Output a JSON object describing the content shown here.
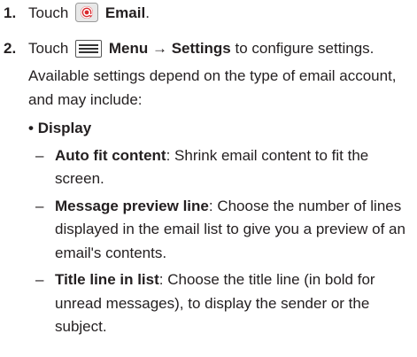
{
  "steps": [
    {
      "num": "1.",
      "pre": "Touch",
      "icon": "email-app-icon",
      "bold": "Email",
      "post": "."
    },
    {
      "num": "2.",
      "pre": "Touch",
      "icon": "menu-icon",
      "bold": "Menu",
      "arrow": "→",
      "bold2": "Settings",
      "post": "to configure settings. Available settings depend on the type of email account, and may include:"
    }
  ],
  "bullet": {
    "marker": "•",
    "label": "Display"
  },
  "options": [
    {
      "dash": "–",
      "label": "Auto fit content",
      "text": ": Shrink email content to fit the screen."
    },
    {
      "dash": "–",
      "label": "Message preview line",
      "text": ": Choose the number of lines displayed in the email list to give you a preview of an email's contents."
    },
    {
      "dash": "–",
      "label": "Title line in list",
      "text": ": Choose the title line (in bold for unread messages), to display the sender or the subject."
    }
  ],
  "colors": {
    "text": "#231f20",
    "icon_bg": "#e8e8e8",
    "icon_red": "#d9262b"
  }
}
